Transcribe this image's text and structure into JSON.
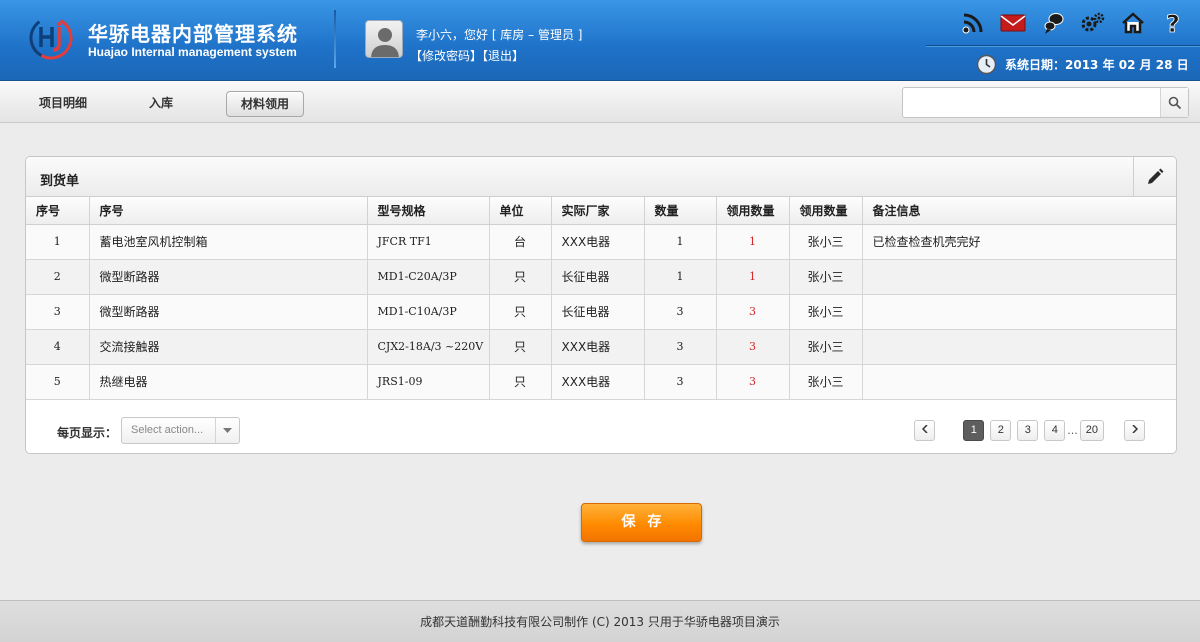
{
  "brand": {
    "name_cn": "华骄电器内部管理系统",
    "name_en": "Huajao Internal management system"
  },
  "user": {
    "greeting": "李小六，您好 [ 库房 – 管理员 ]",
    "change_password": "【修改密码】",
    "logout": "【退出】"
  },
  "top_icons": [
    "rss-icon",
    "mail-icon",
    "chat-icon",
    "settings-icon",
    "home-icon",
    "help-icon"
  ],
  "system_date": "系统日期：2013 年 02 月 28 日",
  "tabs": [
    {
      "label": "项目明细",
      "active": false
    },
    {
      "label": "入库",
      "active": false
    },
    {
      "label": "材料领用",
      "active": true
    }
  ],
  "search": {
    "placeholder": "",
    "value": ""
  },
  "panel": {
    "title": "到货单",
    "columns": [
      "序号",
      "序号",
      "型号规格",
      "单位",
      "实际厂家",
      "数量",
      "领用数量",
      "领用数量",
      "备注信息"
    ],
    "rows": [
      [
        "1",
        "蓄电池室风机控制箱",
        "JFCR TF1",
        "台",
        "XXX电器",
        "1",
        "1",
        "张小三",
        "已检查检查机壳完好"
      ],
      [
        "2",
        "微型断路器",
        "MD1-C20A/3P",
        "只",
        "长征电器",
        "1",
        "1",
        "张小三",
        ""
      ],
      [
        "3",
        "微型断路器",
        "MD1-C10A/3P",
        "只",
        "长征电器",
        "3",
        "3",
        "张小三",
        ""
      ],
      [
        "4",
        "交流接触器",
        "CJX2-18A/3 ~220V",
        "只",
        "XXX电器",
        "3",
        "3",
        "张小三",
        ""
      ],
      [
        "5",
        "热继电器",
        "JRS1-09",
        "只",
        "XXX电器",
        "3",
        "3",
        "张小三",
        ""
      ]
    ]
  },
  "pagination": {
    "per_page_label": "每页显示：",
    "select_placeholder": "Select action...",
    "pages": [
      "1",
      "2",
      "3",
      "4"
    ],
    "ellipsis": "...",
    "last_page": "20",
    "current": "1"
  },
  "save_label": "保存",
  "footer_text": "成都天道酬勤科技有限公司制作 (C) 2013 只用于华骄电器项目演示",
  "colors": {
    "header_blue": "#1e72c8",
    "accent_orange": "#ff8a00",
    "issued_qty_red": "#d42a2a"
  }
}
